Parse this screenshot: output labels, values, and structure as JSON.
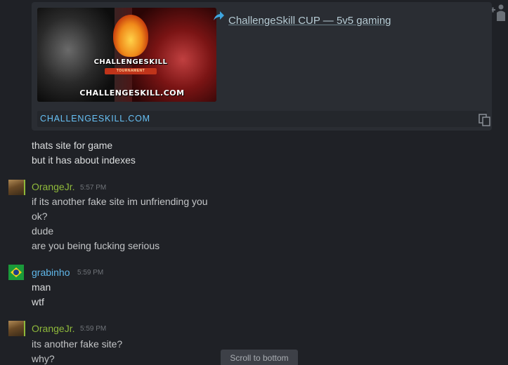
{
  "embed": {
    "title": "ChallengeSkill CUP — 5v5 gaming",
    "url": "CHALLENGESKILL.COM",
    "thumbnail": {
      "logo_text": "CHALLENGESKILL",
      "ribbon_text": "TOURNAMENT",
      "domain_text": "CHALLENGESKILL.COM"
    },
    "icons": {
      "share": "share-arrow-icon",
      "copy": "copy-icon"
    }
  },
  "corner_action": {
    "icon": "add-friend-icon"
  },
  "messages": {
    "m1": "thats site for game",
    "m2": "but it has about indexes",
    "g1": {
      "author": "OrangeJr.",
      "time": "5:57 PM",
      "lines": [
        "if its another fake site im unfriending you",
        "ok?",
        "dude",
        "are you being fucking serious"
      ]
    },
    "g2": {
      "author": "grabinho",
      "time": "5:59 PM",
      "lines": [
        "man",
        "wtf"
      ]
    },
    "g3": {
      "author": "OrangeJr.",
      "time": "5:59 PM",
      "lines": [
        "its another fake site?",
        "why?"
      ]
    }
  },
  "scroll_button": "Scroll to bottom",
  "colors": {
    "background": "#1f2126",
    "link": "#67c1f5",
    "online_name": "#8fb93b",
    "self_name": "#5fb7ea"
  }
}
